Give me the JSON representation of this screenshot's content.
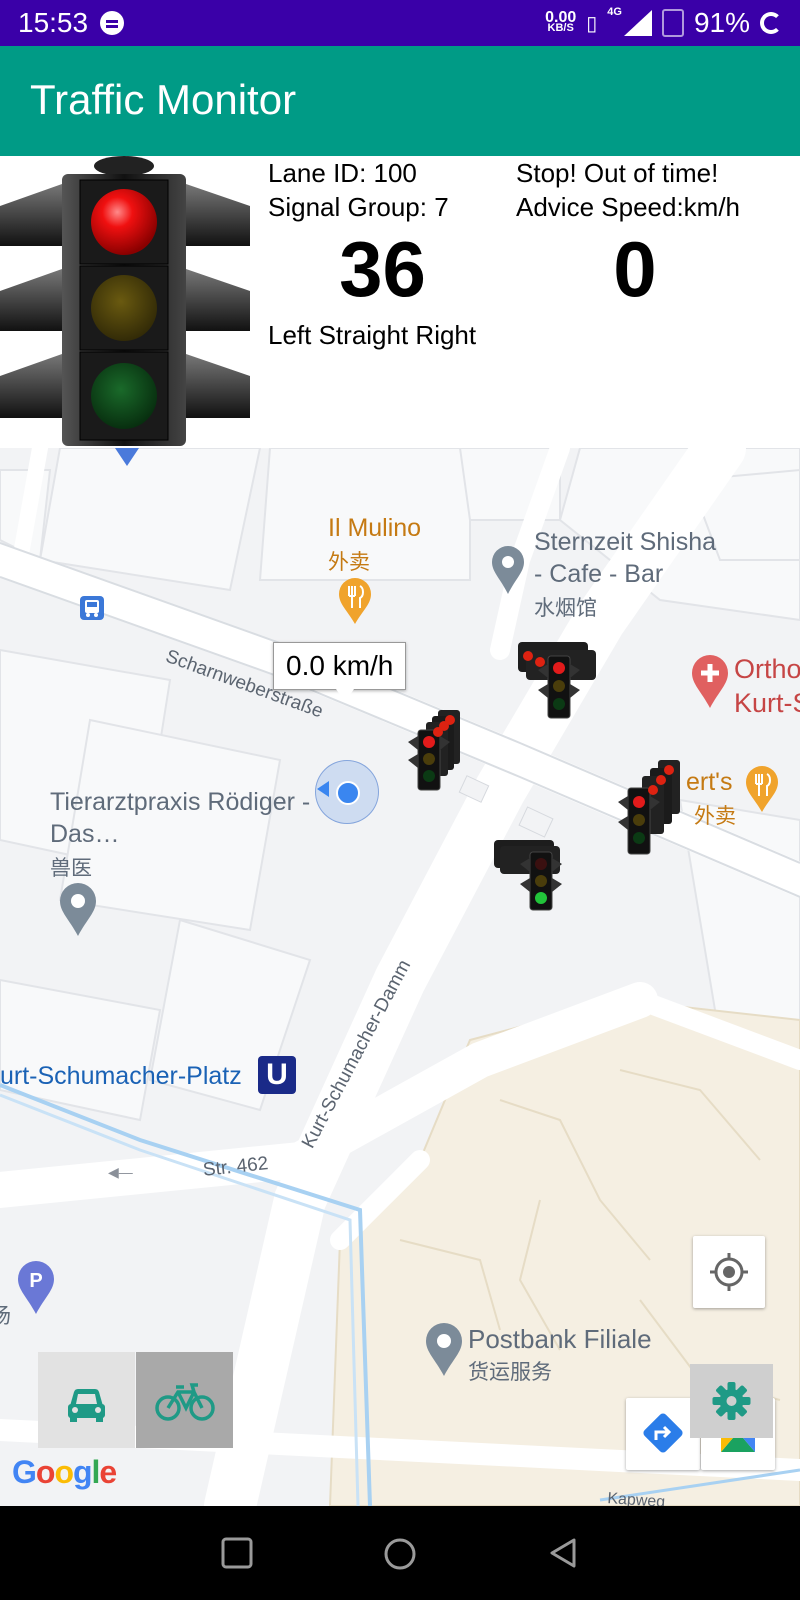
{
  "status_bar": {
    "time": "15:53",
    "net_speed_value": "0.00",
    "net_speed_unit": "KB/S",
    "network_type": "4G",
    "battery": "91%"
  },
  "app": {
    "title": "Traffic Monitor"
  },
  "signal_info": {
    "lane_id": "Lane ID: 100",
    "signal_group": "Signal Group: 7",
    "countdown": "36",
    "directions": "Left Straight Right",
    "status_message": "Stop! Out of time!",
    "advice_speed_label": "Advice Speed:km/h",
    "advice_speed_value": "0",
    "current_light": "red"
  },
  "map": {
    "speed_tooltip": "0.0 km/h",
    "places": {
      "il_mulino": {
        "name": "Il Mulino",
        "sub": "外卖"
      },
      "sternzeit": {
        "name_line1": "Sternzeit Shisha",
        "name_line2": "- Cafe - Bar",
        "sub": "水烟馆"
      },
      "ortho": {
        "name_line1": "Ortho",
        "name_line2": "Kurt-S"
      },
      "erts": {
        "name": "ert's",
        "sub": "外卖"
      },
      "tierarzt": {
        "name_line1": "Tierarztpraxis Rödiger -",
        "name_line2": "Das…",
        "sub": "兽医"
      },
      "kurt_platz": {
        "name": "urt-Schumacher-Platz",
        "badge": "U"
      },
      "postbank": {
        "name": "Postbank Filiale",
        "sub": "货运服务"
      },
      "parking_sub": "场"
    },
    "roads": {
      "scharnweber": "Scharnweberstraße",
      "kurt_damm": "Kurt-Schumacher-Damm",
      "str462": "Str. 462",
      "kapweg": "Kapweg"
    },
    "google_logo": [
      "G",
      "o",
      "o",
      "g",
      "l",
      "e"
    ],
    "logo_colors": [
      "#4285F4",
      "#EA4335",
      "#FBBC05",
      "#4285F4",
      "#34A853",
      "#EA4335"
    ]
  },
  "colors": {
    "status_bar": "#3a00a8",
    "app_bar": "#009b86",
    "icon_teal": "#1f9a86"
  }
}
